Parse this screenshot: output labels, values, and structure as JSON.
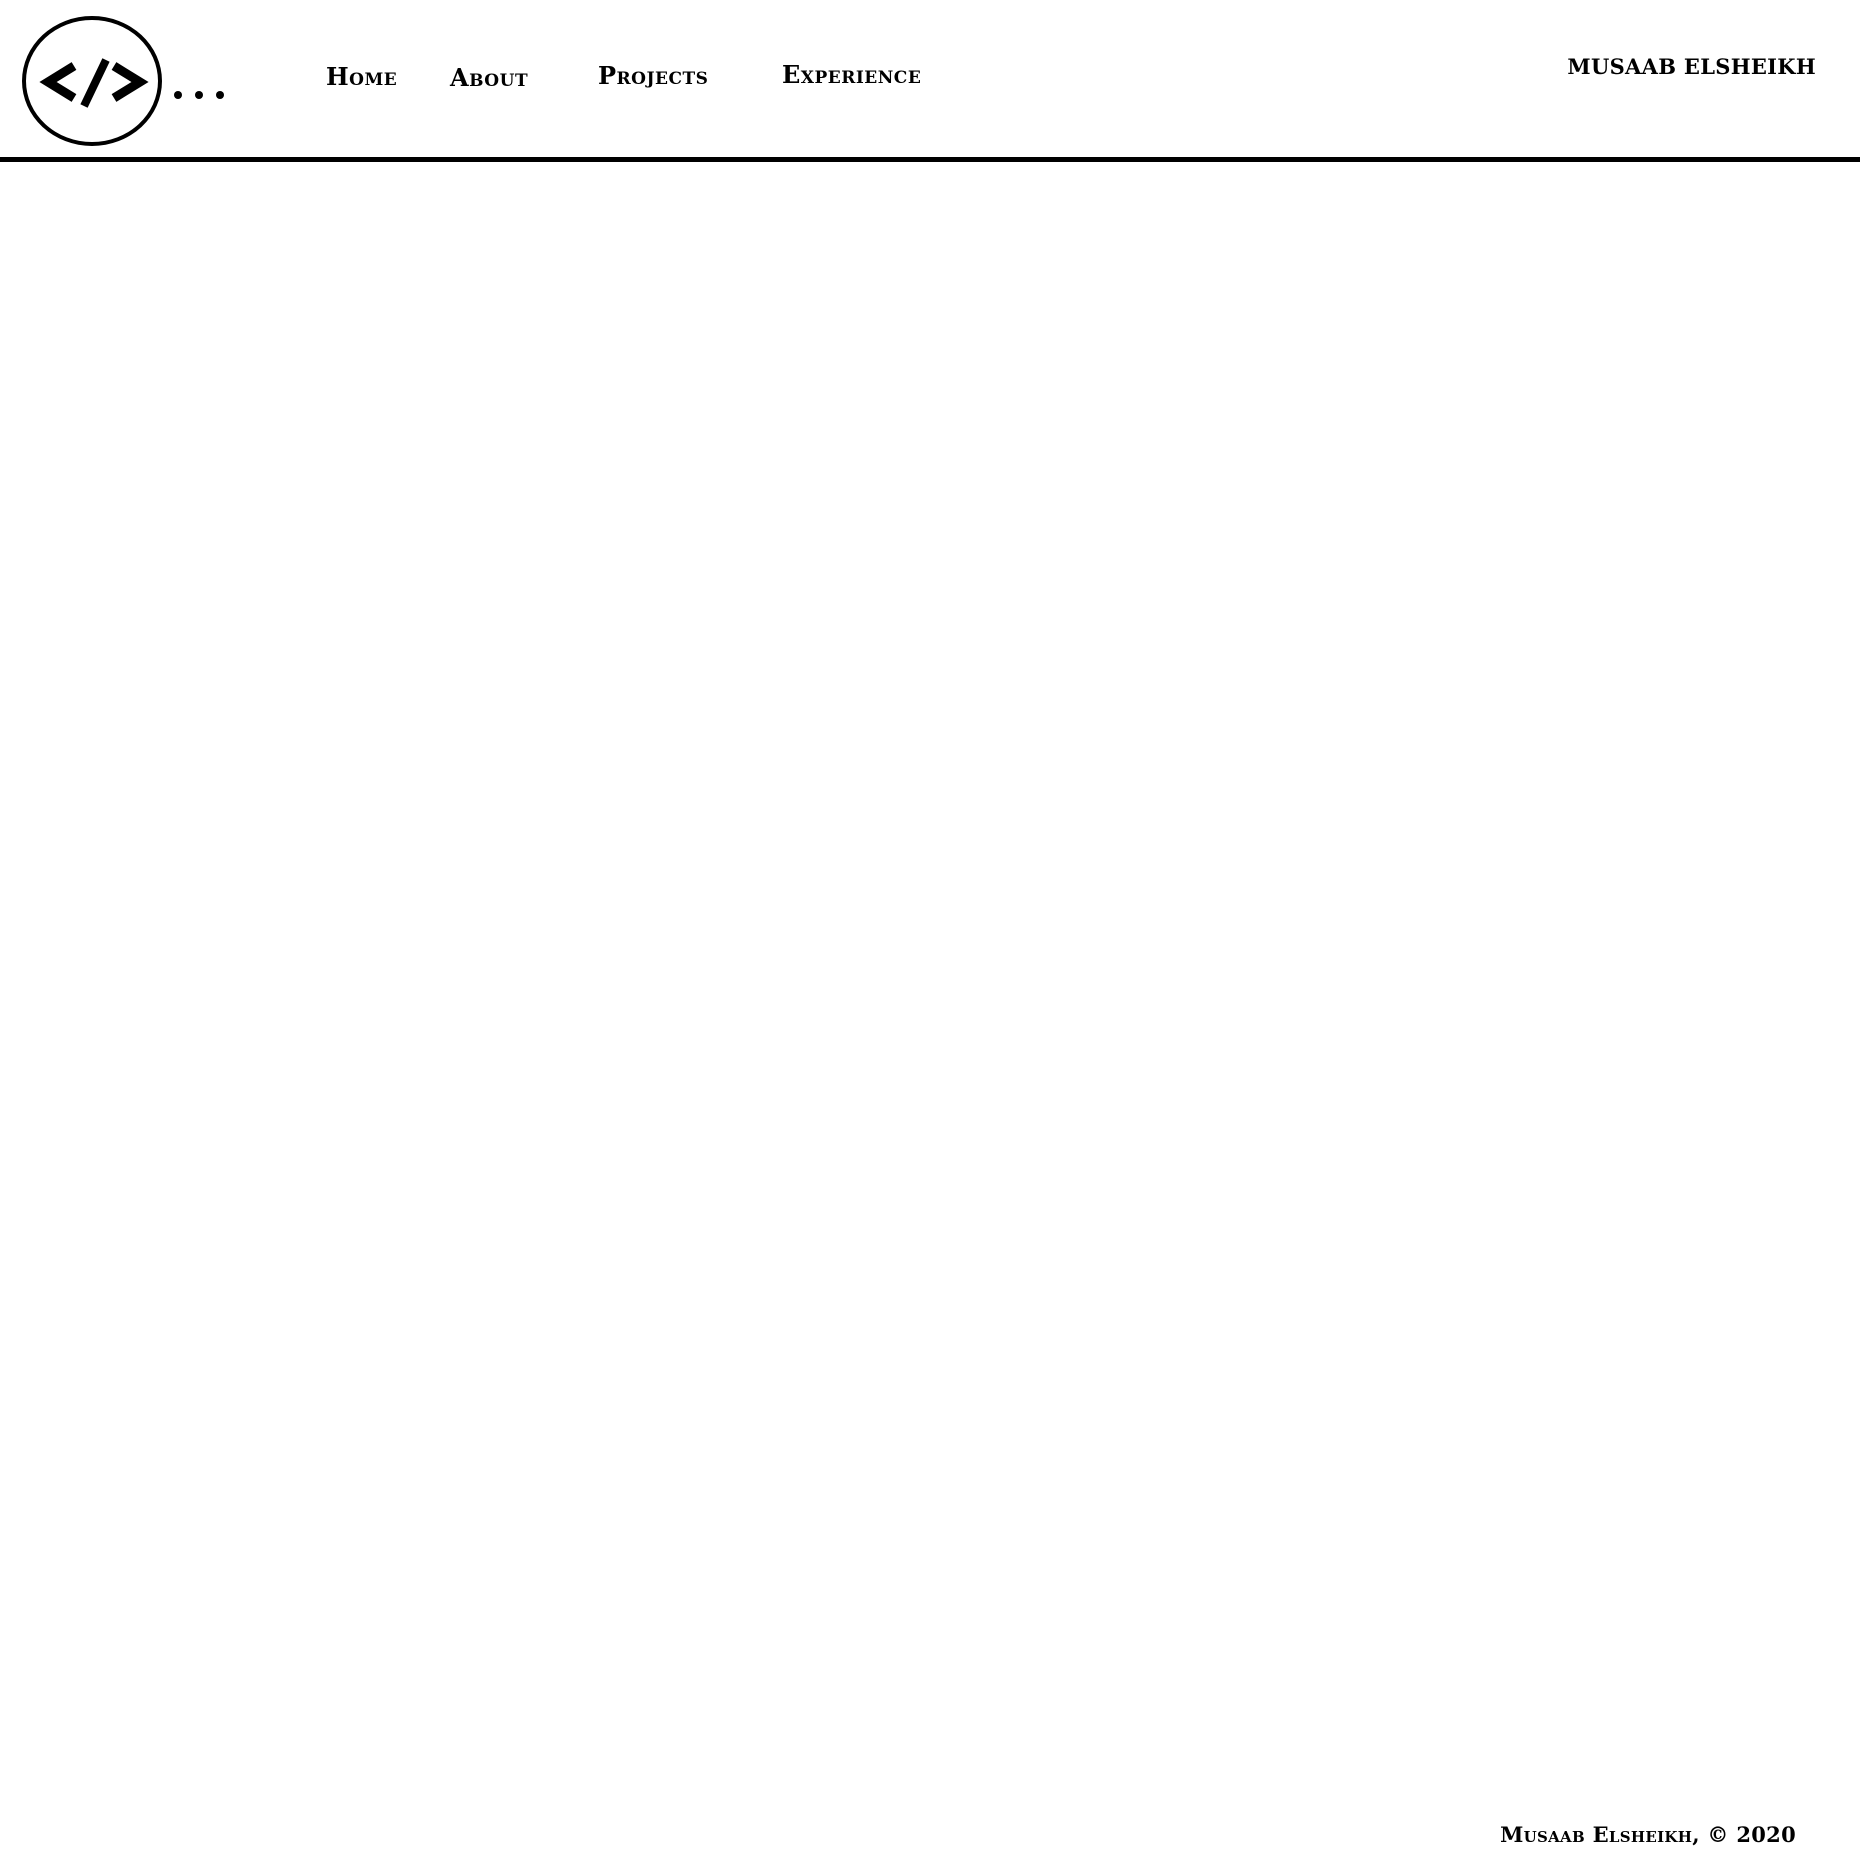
{
  "header": {
    "logo_icon": "code-brackets-icon",
    "nav": {
      "home": "Home",
      "about": "About",
      "projects": "Projects",
      "experience": "Experience"
    },
    "brand_name": "MUSAAB ELSHEIKH"
  },
  "footer": {
    "copyright": "Musaab Elsheikh, © 2020"
  },
  "colors": {
    "background": "#ffffff",
    "foreground": "#000000"
  }
}
